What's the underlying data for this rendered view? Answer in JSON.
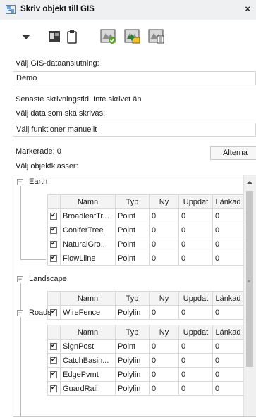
{
  "window": {
    "title": "Skriv objekt till GIS",
    "close_icon": "×"
  },
  "toolbar": {
    "buttons": [
      "dropdown-arrow-icon",
      "layer-window-icon",
      "clipboard-icon",
      "map-sync-icon",
      "map-write-icon",
      "map-export-icon"
    ]
  },
  "connection": {
    "label": "Välj GIS-dataanslutning:",
    "value": "Demo"
  },
  "write_time": "Senaste skrivningstid: Inte skrivet än",
  "data_select": {
    "label": "Välj data som ska skrivas:",
    "value": "Välj funktioner manuellt"
  },
  "selected": "Markerade: 0",
  "alternatives_button": "Alterna",
  "classes_label": "Välj objektklasser:",
  "columns": [
    "Namn",
    "Typ",
    "Ny",
    "Uppdat",
    "Länkad"
  ],
  "groups": [
    {
      "name": "Earth",
      "expander": "−",
      "rows": [
        {
          "checked": true,
          "name": "BroadleafTr...",
          "type": "Point",
          "new": "0",
          "updated": "0",
          "linked": "0"
        },
        {
          "checked": true,
          "name": "ConiferTree",
          "type": "Point",
          "new": "0",
          "updated": "0",
          "linked": "0"
        },
        {
          "checked": true,
          "name": "NaturalGro...",
          "type": "Point",
          "new": "0",
          "updated": "0",
          "linked": "0"
        },
        {
          "checked": true,
          "name": "FlowLline",
          "type": "Point",
          "new": "0",
          "updated": "0",
          "linked": "0"
        }
      ]
    },
    {
      "name": "Landscape",
      "expander": "−",
      "rows": [
        {
          "checked": true,
          "name": "WireFence",
          "type": "Polylin",
          "new": "0",
          "updated": "0",
          "linked": "0"
        }
      ]
    },
    {
      "name": "Roads",
      "expander": "−",
      "rows": [
        {
          "checked": true,
          "name": "SignPost",
          "type": "Point",
          "new": "0",
          "updated": "0",
          "linked": "0"
        },
        {
          "checked": true,
          "name": "CatchBasin...",
          "type": "Polylin",
          "new": "0",
          "updated": "0",
          "linked": "0"
        },
        {
          "checked": true,
          "name": "EdgePvmt",
          "type": "Polylin",
          "new": "0",
          "updated": "0",
          "linked": "0"
        },
        {
          "checked": true,
          "name": "GuardRail",
          "type": "Polylin",
          "new": "0",
          "updated": "0",
          "linked": "0"
        }
      ]
    }
  ],
  "colors": {
    "titlebar": "#eef0f2",
    "green_accent": "#5aa02c",
    "header_bg": "#f4f4f4"
  }
}
